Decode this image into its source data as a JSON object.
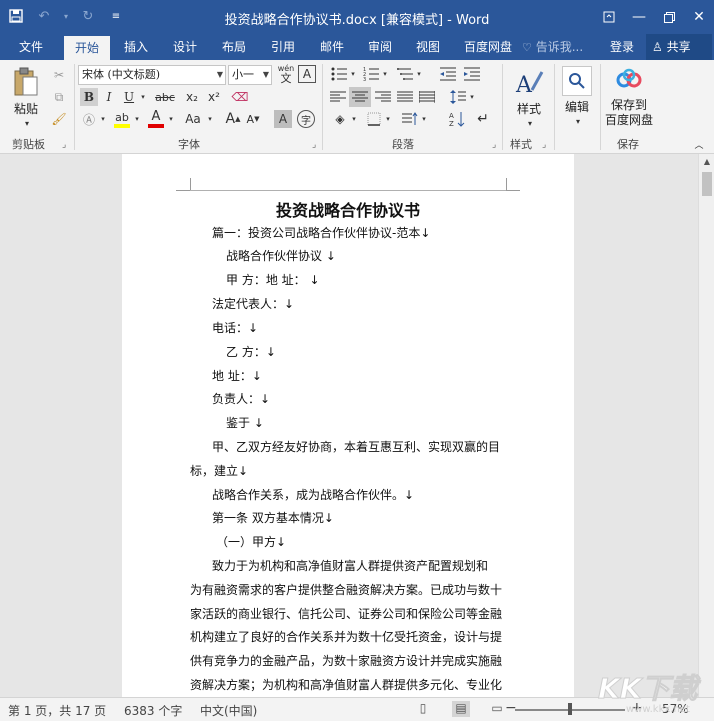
{
  "titlebar": {
    "title": "投资战略合作协议书.docx [兼容模式] - Word",
    "qat": {
      "save_icon": "save-icon",
      "undo_icon": "undo-icon",
      "redo_icon": "redo-icon",
      "customize_icon": "customize-qat-icon"
    }
  },
  "tabs": [
    "文件",
    "开始",
    "插入",
    "设计",
    "布局",
    "引用",
    "邮件",
    "审阅",
    "视图",
    "百度网盘"
  ],
  "active_tab": "开始",
  "tell_me": "告诉我...",
  "login": "登录",
  "share": "共享",
  "ribbon": {
    "clipboard": {
      "label": "剪贴板",
      "paste": "粘贴"
    },
    "font": {
      "label": "字体",
      "font_name": "宋体 (中文标题)",
      "font_size": "小一",
      "phonetic": "wén",
      "bold": "B",
      "italic": "I",
      "underline": "U",
      "strike": "abc",
      "subscript": "x₂",
      "superscript": "x²",
      "case": "Aa",
      "grow": "A",
      "shrink": "A",
      "char_shading": "A",
      "enclose": "字"
    },
    "paragraph": {
      "label": "段落"
    },
    "styles": {
      "label": "样式",
      "button": "样式"
    },
    "editing": {
      "button": "编辑"
    },
    "save": {
      "label": "保存",
      "button_line1": "保存到",
      "button_line2": "百度网盘"
    }
  },
  "document": {
    "title": "投资战略合作协议书",
    "lines": [
      "篇一：投资公司战略合作伙伴协议-范本↓",
      "战略合作伙伴协议 ↓",
      "甲 方：地 址： ↓",
      "法定代表人：↓",
      "电话：↓",
      "乙 方：↓",
      "地 址：↓",
      "负责人：↓",
      "鉴于 ↓",
      "甲、乙双方经友好协商，本着互惠互利、实现双赢的目",
      "标，建立↓",
      "战略合作关系，成为战略合作伙伴。↓",
      "第一条 双方基本情况↓",
      "（一）甲方↓",
      "致力于为机构和高净值财富人群提供资产配置规划和",
      "为有融资需求的客户提供整合融资解决方案。已成功与数十",
      "家活跃的商业银行、信托公司、证券公司和保险公司等金融",
      "机构建立了良好的合作关系并为数十亿受托资金，设计与提",
      "供有竞争力的金融产品，为数十家融资方设计并完成实施融",
      "资解决方案；为机构和高净值财富人群提供多元化、专业化"
    ]
  },
  "status": {
    "page": "第 1 页，共 17 页",
    "words": "6383 个字",
    "language": "中文(中国)",
    "zoom": "57%",
    "zoom_fraction": 0.5
  },
  "watermark": {
    "text": "KK下载",
    "url": "www.kkx.net"
  },
  "colors": {
    "brand": "#2b579a",
    "ribbon": "#f3f3f3",
    "highlight": "#ffff00",
    "font_color": "#e00000"
  }
}
